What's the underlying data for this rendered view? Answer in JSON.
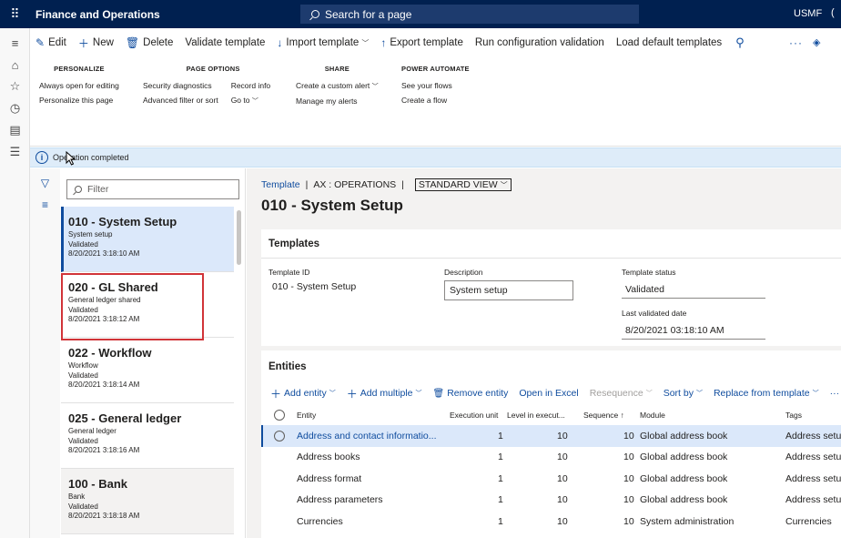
{
  "topbar": {
    "app_title": "Finance and Operations",
    "search_placeholder": "Search for a page",
    "company": "USMF",
    "company_extra": "(",
    "colors": {
      "nav_bg": "#002050",
      "accent": "#0f4c9e"
    }
  },
  "rail": {
    "icons": [
      "hamburger-icon",
      "home-icon",
      "star-icon",
      "clock-icon",
      "workspace-icon",
      "list-icon"
    ]
  },
  "actionpane": {
    "commands": [
      {
        "label": "Edit",
        "icon": "edit-icon"
      },
      {
        "label": "New",
        "icon": "plus-icon"
      },
      {
        "label": "Delete",
        "icon": "trash-icon"
      },
      {
        "label": "Validate template"
      },
      {
        "label": "Import template",
        "icon": "download-icon",
        "has_chevron": true
      },
      {
        "label": "Export template",
        "icon": "upload-icon"
      },
      {
        "label": "Run configuration validation"
      },
      {
        "label": "Load default templates"
      }
    ],
    "more": "···",
    "groups": {
      "personalize": {
        "header": "PERSONALIZE",
        "items": [
          "Always open for editing",
          "Personalize this page"
        ]
      },
      "page_options": {
        "header": "PAGE OPTIONS",
        "col1": [
          "Security diagnostics",
          "Advanced filter or sort"
        ],
        "col2": [
          "Record info",
          "Go to"
        ]
      },
      "share": {
        "header": "SHARE",
        "items": [
          "Create a custom alert",
          "Manage my alerts"
        ]
      },
      "power_automate": {
        "header": "POWER AUTOMATE",
        "items": [
          "See your flows",
          "Create a flow"
        ]
      }
    }
  },
  "message": {
    "text": "Operation completed"
  },
  "list": {
    "filter_placeholder": "Filter",
    "items": [
      {
        "title": "010 - System Setup",
        "desc": "System setup",
        "status": "Validated",
        "date": "8/20/2021 3:18:10 AM"
      },
      {
        "title": "020 - GL Shared",
        "desc": "General ledger shared",
        "status": "Validated",
        "date": "8/20/2021 3:18:12 AM"
      },
      {
        "title": "022 - Workflow",
        "desc": "Workflow",
        "status": "Validated",
        "date": "8/20/2021 3:18:14 AM"
      },
      {
        "title": "025 - General ledger",
        "desc": "General ledger",
        "status": "Validated",
        "date": "8/20/2021 3:18:16 AM"
      },
      {
        "title": "100 - Bank",
        "desc": "Bank",
        "status": "Validated",
        "date": "8/20/2021 3:18:18 AM"
      }
    ]
  },
  "detail": {
    "breadcrumb": {
      "link": "Template",
      "context": "AX : OPERATIONS",
      "view": "STANDARD VIEW"
    },
    "title": "010 - System Setup",
    "templates": {
      "header": "Templates",
      "template_id_label": "Template ID",
      "template_id": "010 - System Setup",
      "description_label": "Description",
      "description": "System setup",
      "status_label": "Template status",
      "status": "Validated",
      "last_validated_label": "Last validated date",
      "last_validated": "8/20/2021 03:18:10 AM"
    },
    "entities": {
      "header": "Entities",
      "toolbar": {
        "add_entity": "Add entity",
        "add_multiple": "Add multiple",
        "remove_entity": "Remove entity",
        "open_excel": "Open in Excel",
        "resequence": "Resequence",
        "sort_by": "Sort by",
        "replace": "Replace from template",
        "more": "···"
      },
      "columns": {
        "entity": "Entity",
        "exec_unit": "Execution unit",
        "level": "Level in execut...",
        "sequence": "Sequence",
        "sort_indicator": "↑",
        "module": "Module",
        "tags": "Tags"
      },
      "rows": [
        {
          "entity": "Address and contact informatio...",
          "exec_unit": "1",
          "level": "10",
          "sequence": "10",
          "module": "Global address book",
          "tags": "Address setu"
        },
        {
          "entity": "Address books",
          "exec_unit": "1",
          "level": "10",
          "sequence": "10",
          "module": "Global address book",
          "tags": "Address setu"
        },
        {
          "entity": "Address format",
          "exec_unit": "1",
          "level": "10",
          "sequence": "10",
          "module": "Global address book",
          "tags": "Address setu"
        },
        {
          "entity": "Address parameters",
          "exec_unit": "1",
          "level": "10",
          "sequence": "10",
          "module": "Global address book",
          "tags": "Address setu"
        },
        {
          "entity": "Currencies",
          "exec_unit": "1",
          "level": "10",
          "sequence": "10",
          "module": "System administration",
          "tags": "Currencies"
        }
      ]
    }
  }
}
